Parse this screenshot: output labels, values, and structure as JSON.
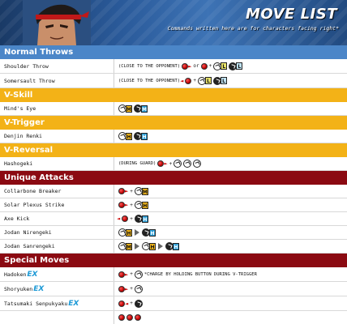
{
  "header": {
    "title": "MOVE LIST",
    "subtitle": "Commands written here are for characters facing right*"
  },
  "sections": {
    "normal_throws": "Normal Throws",
    "v_skill": "V-Skill",
    "v_trigger": "V-Trigger",
    "v_reversal": "V-Reversal",
    "unique_attacks": "Unique Attacks",
    "special_moves": "Special Moves"
  },
  "moves": {
    "shoulder_throw": {
      "name": "Shoulder Throw",
      "note": "(CLOSE TO THE OPPONENT)",
      "or": "or"
    },
    "somersault_throw": {
      "name": "Somersault Throw",
      "note": "(CLOSE TO THE OPPONENT)"
    },
    "minds_eye": {
      "name": "Mind's Eye"
    },
    "denjin_renki": {
      "name": "Denjin Renki"
    },
    "hashogeki": {
      "name": "Hashogeki",
      "note": "(DURING GUARD)"
    },
    "collarbone_breaker": {
      "name": "Collarbone Breaker"
    },
    "solar_plexus_strike": {
      "name": "Solar Plexus Strike"
    },
    "axe_kick": {
      "name": "Axe Kick"
    },
    "jodan_nirengeki": {
      "name": "Jodan Nirengeki"
    },
    "jodan_sanrengeki": {
      "name": "Jodan Sanrengeki"
    },
    "hadoken": {
      "name": "Hadoken",
      "ex": "EX",
      "note": "*CHARGE BY HOLDING BUTTON DURING V-TRIGGER"
    },
    "shoryuken": {
      "name": "Shoryuken",
      "ex": "EX"
    },
    "tatsumaki": {
      "name": "Tatsumaki Senpukyaku",
      "ex": "EX"
    }
  },
  "buttons": {
    "M": "M",
    "H": "H",
    "L": "L"
  },
  "colors": {
    "normal_throws": "#4b86c8",
    "v_sections": "#f3b217",
    "attacks": "#8b0a12",
    "ex": "#1e9ad6"
  }
}
